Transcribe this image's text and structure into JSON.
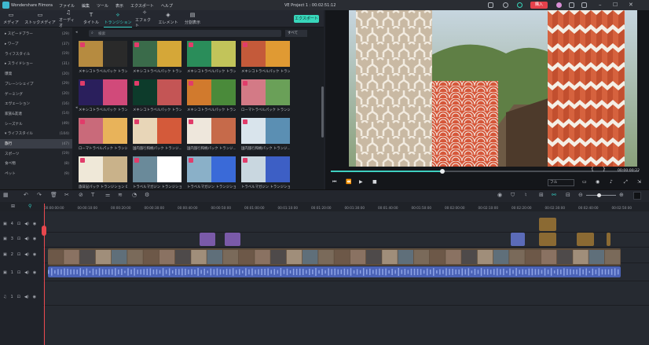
{
  "app": {
    "name": "Wondershare Filmora",
    "project_title": "VE Project 1 : 00:02:51:12",
    "buy_label": "購入"
  },
  "menu": [
    "ファイル",
    "編集",
    "ツール",
    "表示",
    "エクスポート",
    "ヘルプ"
  ],
  "toolbar": {
    "tabs": [
      {
        "label": "メディア",
        "icon": "folder-icon"
      },
      {
        "label": "ストックメディア",
        "icon": "cloud-folder-icon"
      },
      {
        "label": "オーディオ",
        "icon": "music-note-icon"
      },
      {
        "label": "タイトル",
        "icon": "text-icon"
      },
      {
        "label": "トランジション",
        "icon": "transition-icon",
        "active": true
      },
      {
        "label": "エフェクト",
        "icon": "effects-icon"
      },
      {
        "label": "エレメント",
        "icon": "elements-icon"
      },
      {
        "label": "分割表示",
        "icon": "split-screen-icon"
      }
    ],
    "export_label": "エクスポート"
  },
  "categories": [
    {
      "label": "スピードブラー",
      "count": "(29)",
      "arrow": "▸"
    },
    {
      "label": "ワープ",
      "count": "(37)",
      "arrow": "▸"
    },
    {
      "label": "ライフスタイル",
      "count": "(19)",
      "arrow": ""
    },
    {
      "label": "スライドショー",
      "count": "(31)",
      "arrow": "▸"
    },
    {
      "label": "爆発",
      "count": "(20)",
      "arrow": ""
    },
    {
      "label": "ブレーンシェイプ",
      "count": "(29)",
      "arrow": ""
    },
    {
      "label": "ゲーミング",
      "count": "(20)",
      "arrow": ""
    },
    {
      "label": "エヴェーション",
      "count": "(16)",
      "arrow": ""
    },
    {
      "label": "家族&友達",
      "count": "(14)",
      "arrow": ""
    },
    {
      "label": "シーズナル",
      "count": "(49)",
      "arrow": ""
    },
    {
      "label": "ライフスタイル",
      "count": "(104)",
      "arrow": "▾"
    },
    {
      "label": "旅行",
      "count": "(47)",
      "arrow": "",
      "selected": true
    },
    {
      "label": "スポーツ",
      "count": "(19)",
      "arrow": ""
    },
    {
      "label": "食べ物",
      "count": "(8)",
      "arrow": ""
    },
    {
      "label": "ペット",
      "count": "(9)",
      "arrow": ""
    }
  ],
  "search": {
    "placeholder": "検索",
    "filter": "すべて"
  },
  "transitions": [
    {
      "label": "メキシコトラベルパック トランジ..."
    },
    {
      "label": "メキシコトラベルパック トランジ..."
    },
    {
      "label": "メキシコトラベルパック トランジ..."
    },
    {
      "label": "メキシコトラベルパック トランジ..."
    },
    {
      "label": "メキシコトラベルパック トランジ..."
    },
    {
      "label": "メキシコトラベルパック トランジ..."
    },
    {
      "label": "メキシコトラベルパック トランジ..."
    },
    {
      "label": "ローマトラベルパック トランジ..."
    },
    {
      "label": "ローマトラベルパック トランジション..."
    },
    {
      "label": "国内旅行和柄パック トランジ..."
    },
    {
      "label": "国内旅行和柄パック トランジ..."
    },
    {
      "label": "国内旅行和柄パック トランジ..."
    },
    {
      "label": "旅日記パック トランジション 09"
    },
    {
      "label": "トラベルマガジン トランジション..."
    },
    {
      "label": "トラベルマガジン トランジション..."
    },
    {
      "label": "トラベルマガジン トランジション..."
    }
  ],
  "player": {
    "current_time": "00:00:00:22",
    "quality": "フル",
    "in_mark": "{",
    "out_mark": "}"
  },
  "ruler": [
    "00:00:00:00",
    "00:00:10:00",
    "00:00:20:00",
    "00:00:30:00",
    "00:00:40:00",
    "00:00:50:00",
    "00:01:00:00",
    "00:01:10:00",
    "00:01:20:00",
    "00:01:30:00",
    "00:01:40:00",
    "00:01:50:00",
    "00:02:00:00",
    "00:02:10:00",
    "00:02:20:00",
    "00:02:30:00",
    "00:02:40:00",
    "00:02:50:00"
  ],
  "tracks": [
    {
      "id": "4",
      "type": "video"
    },
    {
      "id": "3",
      "type": "video"
    },
    {
      "id": "2",
      "type": "video"
    },
    {
      "id": "1",
      "type": "video"
    },
    {
      "id": "1",
      "type": "audio"
    }
  ],
  "colors": {
    "accent": "#35d1c6",
    "playhead": "#e8474d",
    "buy": "#e5414b"
  }
}
